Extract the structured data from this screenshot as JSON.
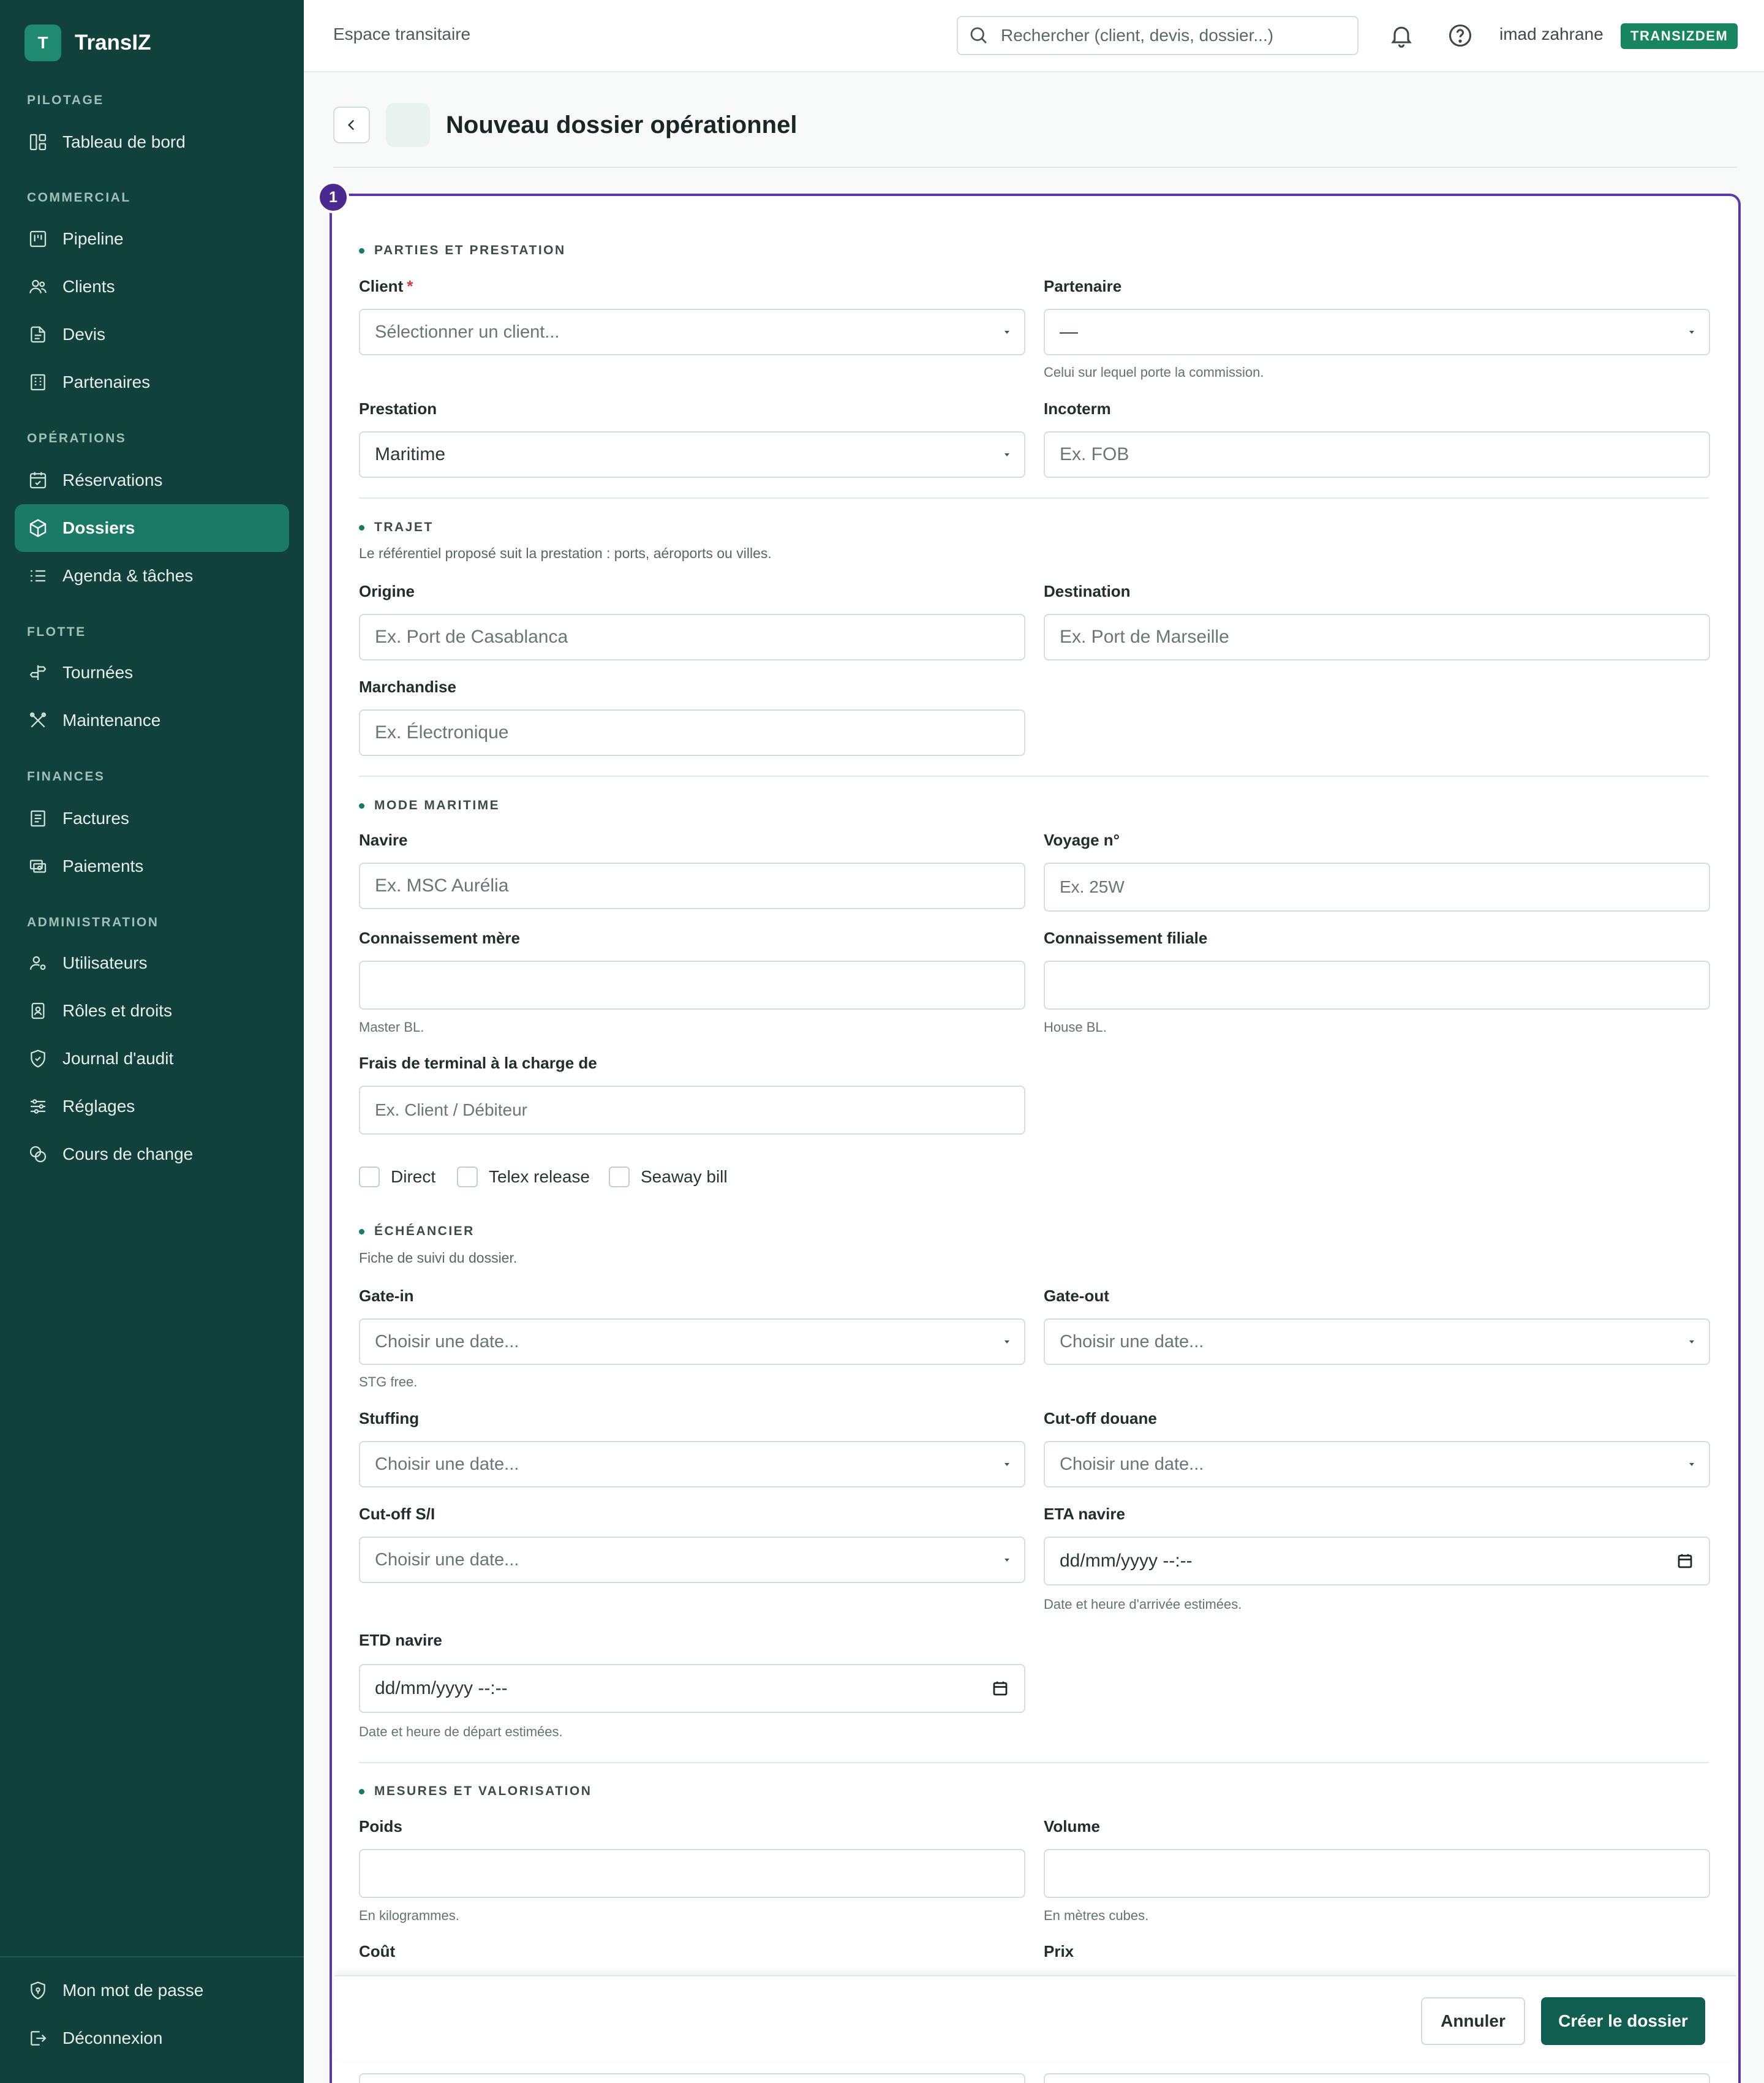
{
  "app": {
    "logo_letter": "T",
    "name": "TransIZ"
  },
  "sidebar": {
    "sections": {
      "pilotage": "PILOTAGE",
      "commercial": "COMMERCIAL",
      "operations": "OPÉRATIONS",
      "flotte": "FLOTTE",
      "finances": "FINANCES",
      "administration": "ADMINISTRATION"
    },
    "items": {
      "tableau": "Tableau de bord",
      "pipeline": "Pipeline",
      "clients": "Clients",
      "devis": "Devis",
      "partenaires": "Partenaires",
      "reservations": "Réservations",
      "dossiers": "Dossiers",
      "agenda": "Agenda & tâches",
      "tournees": "Tournées",
      "maintenance": "Maintenance",
      "factures": "Factures",
      "paiements": "Paiements",
      "utilisateurs": "Utilisateurs",
      "roles": "Rôles et droits",
      "audit": "Journal d'audit",
      "reglages": "Réglages",
      "change": "Cours de change",
      "password": "Mon mot de passe",
      "logout": "Déconnexion"
    },
    "active_item": "dossiers"
  },
  "topbar": {
    "label": "Espace transitaire",
    "search_placeholder": "Rechercher (client, devis, dossier...)",
    "username": "imad zahrane",
    "tenant": "TRANSIZDEM"
  },
  "page": {
    "title": "Nouveau dossier opérationnel",
    "step": "1"
  },
  "form": {
    "parties": {
      "title": "PARTIES ET PRESTATION",
      "client_label": "Client",
      "client_required": "*",
      "client_placeholder": "Sélectionner un client...",
      "partenaire_label": "Partenaire",
      "partenaire_value": "—",
      "partenaire_hint": "Celui sur lequel porte la commission.",
      "prestation_label": "Prestation",
      "prestation_value": "Maritime",
      "incoterm_label": "Incoterm",
      "incoterm_placeholder": "Ex. FOB"
    },
    "trajet": {
      "title": "TRAJET",
      "desc": "Le référentiel proposé suit la prestation : ports, aéroports ou villes.",
      "origine_label": "Origine",
      "origine_placeholder": "Ex. Port de Casablanca",
      "destination_label": "Destination",
      "destination_placeholder": "Ex. Port de Marseille",
      "marchandise_label": "Marchandise",
      "marchandise_placeholder": "Ex. Électronique"
    },
    "maritime": {
      "title": "MODE MARITIME",
      "navire_label": "Navire",
      "navire_placeholder": "Ex. MSC Aurélia",
      "voyage_label": "Voyage n°",
      "voyage_placeholder": "Ex. 25W",
      "bl_mere_label": "Connaissement mère",
      "bl_mere_hint": "Master BL.",
      "bl_filiale_label": "Connaissement filiale",
      "bl_filiale_hint": "House BL.",
      "frais_label": "Frais de terminal à la charge de",
      "frais_placeholder": "Ex. Client / Débiteur",
      "check_direct": "Direct",
      "check_telex": "Telex release",
      "check_seaway": "Seaway bill"
    },
    "echeancier": {
      "title": "ÉCHÉANCIER",
      "desc": "Fiche de suivi du dossier.",
      "date_placeholder": "Choisir une date...",
      "datetime_placeholder": "dd/mm/yyyy --:--",
      "gate_in_label": "Gate-in",
      "gate_in_hint": "STG free.",
      "gate_out_label": "Gate-out",
      "stuffing_label": "Stuffing",
      "cutoff_douane_label": "Cut-off douane",
      "cutoff_si_label": "Cut-off S/I",
      "eta_label": "ETA navire",
      "eta_hint": "Date et heure d'arrivée estimées.",
      "etd_label": "ETD navire",
      "etd_hint": "Date et heure de départ estimées."
    },
    "mesures": {
      "title": "MESURES ET VALORISATION",
      "poids_label": "Poids",
      "poids_hint": "En kilogrammes.",
      "volume_label": "Volume",
      "volume_hint": "En mètres cubes.",
      "cout_label": "Coût",
      "prix_label": "Prix"
    }
  },
  "actions": {
    "cancel": "Annuler",
    "create": "Créer le dossier"
  },
  "colors": {
    "sidebar": "#10413a",
    "active": "#1a7a66",
    "accent": "#5b3aa6",
    "primary_button": "#0f5e50",
    "badge": "#17865e"
  }
}
